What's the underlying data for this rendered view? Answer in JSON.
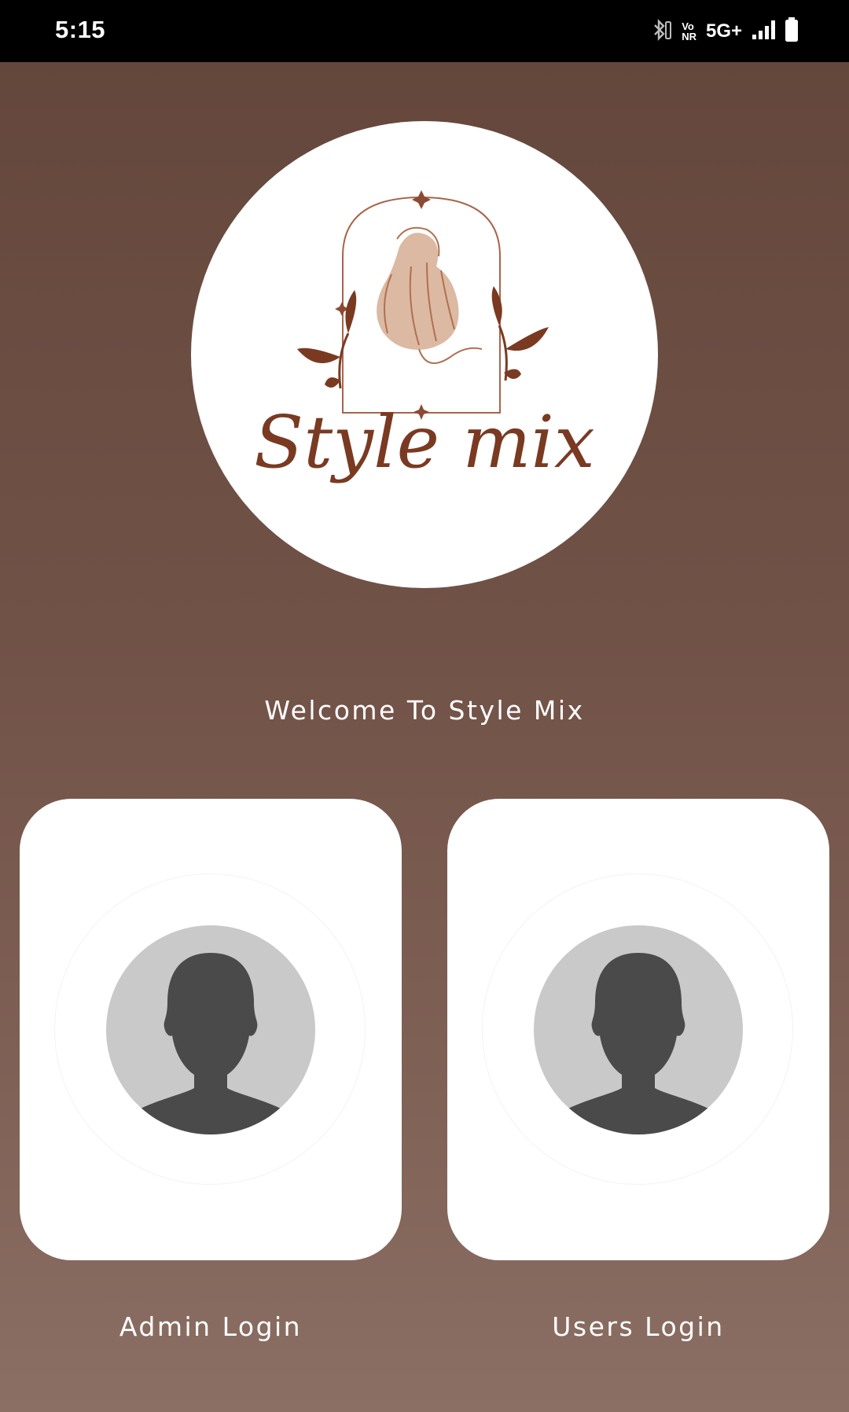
{
  "status_bar": {
    "time": "5:15",
    "network": "5G+",
    "vonr_top": "Vo",
    "vonr_bottom": "NR",
    "icons": [
      "bluetooth-icon",
      "vonr-icon",
      "signal-icon",
      "battery-icon"
    ]
  },
  "logo": {
    "text": "Style mix"
  },
  "welcome_text": "Welcome To Style Mix",
  "login_options": [
    {
      "label": "Admin Login",
      "icon": "avatar-placeholder-icon"
    },
    {
      "label": "Users Login",
      "icon": "avatar-placeholder-icon"
    }
  ],
  "colors": {
    "background_top": "#63463b",
    "background_bottom": "#8b6f64",
    "logo_brown": "#7a3a22",
    "logo_tan": "#dcb9a3",
    "avatar_bg": "#c9c9c9",
    "avatar_fg": "#4a4a4a"
  }
}
